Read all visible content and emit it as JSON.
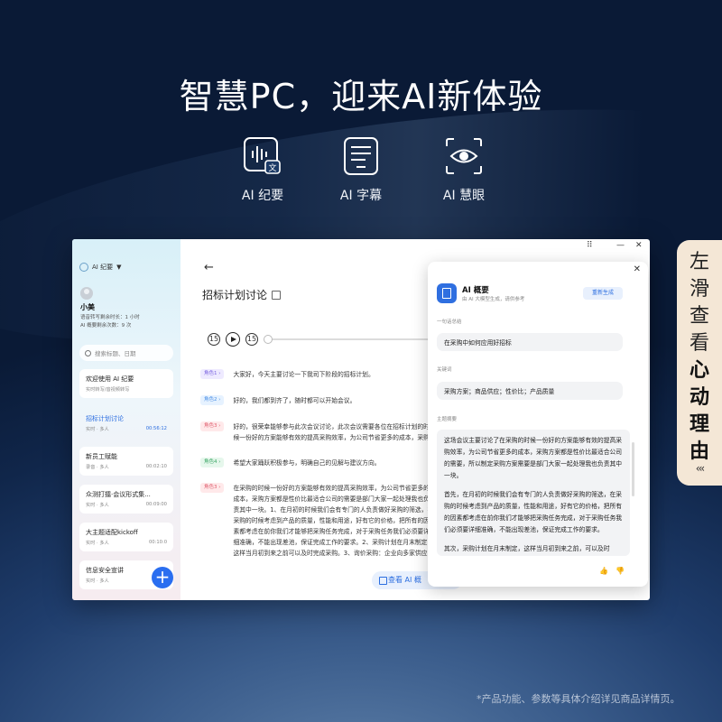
{
  "headline": "智慧PC，迎来AI新体验",
  "features": [
    {
      "label": "AI 纪要",
      "icon": "voice-to-text-icon"
    },
    {
      "label": "AI 字幕",
      "icon": "subtitle-icon"
    },
    {
      "label": "AI 慧眼",
      "icon": "eye-icon"
    }
  ],
  "sidebar": {
    "app_name": "AI 纪要",
    "user_name": "小美",
    "meta": [
      "语音转写剩余时长：1 小时",
      "AI 概要剩余次数：9 次"
    ],
    "search_placeholder": "搜索标题、日期",
    "items": [
      {
        "title": "欢迎使用 AI 纪要",
        "sub": "实时转写/音视频转写",
        "time": ""
      },
      {
        "title": "招标计划讨论",
        "sub": "实时 · 多人",
        "time": "00:56:12"
      },
      {
        "title": "新员工赋能",
        "sub": "录音 · 多人",
        "time": "00:02:10"
      },
      {
        "title": "众测打擂·会议形式集...",
        "sub": "实时 · 多人",
        "time": "00:09:00"
      },
      {
        "title": "大主题适配kickoff",
        "sub": "实时 · 多人",
        "time": "00:10:0"
      },
      {
        "title": "信息安全宣讲",
        "sub": "实时 · 多人",
        "time": "0"
      }
    ]
  },
  "main": {
    "title": "招标计划讨论",
    "view_button": "查看 AI 概",
    "player": {
      "rewind": "15",
      "forward": "15"
    },
    "transcript": [
      {
        "role": "角色1 ›",
        "text": "大家好，今天主要讨论一下我司下阶段的招标计划。"
      },
      {
        "role": "角色2 ›",
        "text": "好的，我们都到齐了，随时都可以开始会议。"
      },
      {
        "role": "角色3 ›",
        "text": "好的，很荣幸能够参与此次会议讨论，此次会议需要各位在招标计划的时候一份好的方案能够有效的提高采购效率，为公司节省更多的成本，采购方案都是性价比最适合公司的需要。"
      },
      {
        "role": "角色4 ›",
        "text": "希望大家踊跃积极参与，明确自己的见解与建议方向。"
      },
      {
        "role": "角色3 ›",
        "text": "在采购的时候一份好的方案能够有效的提高采购效率，为公司节省更多的成本，采购方案都是性价比最适合公司的需要是部门大家一起处理我也负责其中一块。1、在月初的时候我们会有专门的人负责做好采购的筛选，在采购的时候考虑到产品的质量，性能和用途，好有它的价格，把所有的因素都考虑在前你我们才能够把采购任务完成，对于采购任务我们必须要详细准确，不能出现差池，保证完成工作的要求。2、采购计划在月末制定，这样当月初到来之前可以及时完成采购。3、询价采购：企业向多家供应商发出询价单，收集价格信息，然后综合比较选择最优惠或服务。4、供应链采购：企业与供应商建立长期合作关系，共同优化供应链管理，实现双方的紧密合作关系的情况。"
      }
    ]
  },
  "panel": {
    "title": "AI 概要",
    "subtitle": "由 AI 大模型生成，请供参考",
    "regen_label": "重新生成",
    "one_liner_label": "一句话总结",
    "one_liner": "在采购中如何应用好招标",
    "keywords_label": "关键词",
    "keywords": "采购方案；商品供应；性价比；产品质量",
    "summary_label": "主题摘要",
    "summary": [
      "这场会议主要讨论了在采购的时候一份好的方案能够有效的提高采购效率，为公司节省更多的成本，采购方案都是性价比最适合公司的需要，所以制定采购方案需要是部门大家一起处理我也负责其中一块。",
      "首先，在月初的时候我们会有专门的人负责做好采购的筛选，在采购的时候考虑到产品的质量，性能和用途，好有它的价格，把所有的因素都考虑在前你我们才能够把采购任务完成，对于采购任务我们必须要详细准确，不能出现差池，保证完成工作的要求。",
      "其次，采购计划在月末制定，这样当月初到来之前，可以及时"
    ]
  },
  "side_tab": [
    "左",
    "滑",
    "查",
    "看",
    "心",
    "动",
    "理",
    "由"
  ],
  "footnote": "*产品功能、参数等具体介绍详见商品详情页。"
}
